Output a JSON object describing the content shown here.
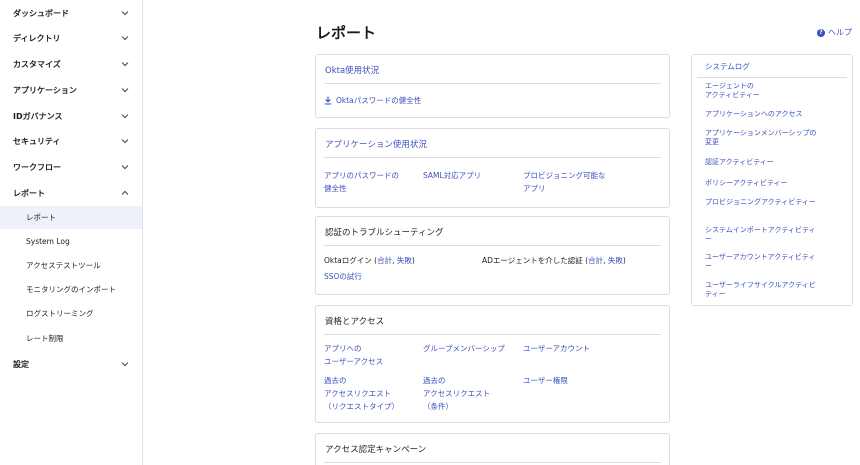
{
  "sidebar": {
    "items": [
      {
        "label": "ダッシュボード"
      },
      {
        "label": "ディレクトリ"
      },
      {
        "label": "カスタマイズ"
      },
      {
        "label": "アプリケーション"
      },
      {
        "label": "IDガバナンス"
      },
      {
        "label": "セキュリティ"
      },
      {
        "label": "ワークフロー"
      },
      {
        "label": "レポート"
      },
      {
        "label": "設定"
      }
    ],
    "sub_items": [
      {
        "label": "レポート"
      },
      {
        "label": "System Log"
      },
      {
        "label": "アクセステストツール"
      },
      {
        "label": "モニタリングのインポート"
      },
      {
        "label": "ログストリーミング"
      },
      {
        "label": "レート制限"
      }
    ]
  },
  "header": {
    "title": "レポート",
    "help_label": "ヘルプ"
  },
  "cards": {
    "okta_usage": {
      "title": "Okta使用状況",
      "link": "Oktaパスワードの健全性"
    },
    "app_usage": {
      "title": "アプリケーション使用状況",
      "links": [
        "アプリのパスワードの\n健全性",
        "SAML対応アプリ",
        "プロビジョニング可能な\nアプリ"
      ]
    },
    "auth_troubleshoot": {
      "title": "認証のトラブルシューティング",
      "okta_login": "Oktaログイン (",
      "okta_total": "合計",
      "okta_sep": ", ",
      "okta_fail": "失敗",
      "okta_end": ")",
      "ad_login": "ADエージェントを介した認証 (",
      "ad_total": "合計",
      "ad_sep": ", ",
      "ad_fail": "失敗",
      "ad_end": ")",
      "sso": "SSOの試行"
    },
    "entitlements": {
      "title": "資格とアクセス",
      "links": [
        "アプリへの\nユーザーアクセス",
        "グループメンバーシップ",
        "ユーザーアカウント",
        "過去の\nアクセスリクエスト\n（リクエストタイプ）",
        "過去の\nアクセスリクエスト\n（条件）",
        "ユーザー権限"
      ]
    },
    "campaign": {
      "title": "アクセス認定キャンペーン"
    }
  },
  "right_panel": {
    "title": "システムログ",
    "links": [
      "エージェントの\nアクティビティー",
      "アプリケーションへのアクセス",
      "アプリケーションメンバーシップの変更",
      "認証アクティビティー",
      "ポリシーアクティビティー",
      "プロビジョニングアクティビティー",
      "システムインポートアクティビティー",
      "ユーザーアカウントアクティビティー",
      "ユーザーライフサイクルアクティビティー"
    ]
  },
  "colors": {
    "link": "#3b4fbf",
    "active_bg": "#eef0fa",
    "border": "#dcdce2"
  },
  "icons": {
    "expand": "chevron-down-icon",
    "collapse": "chevron-up-icon",
    "help": "help-circle-icon",
    "download": "download-icon"
  }
}
